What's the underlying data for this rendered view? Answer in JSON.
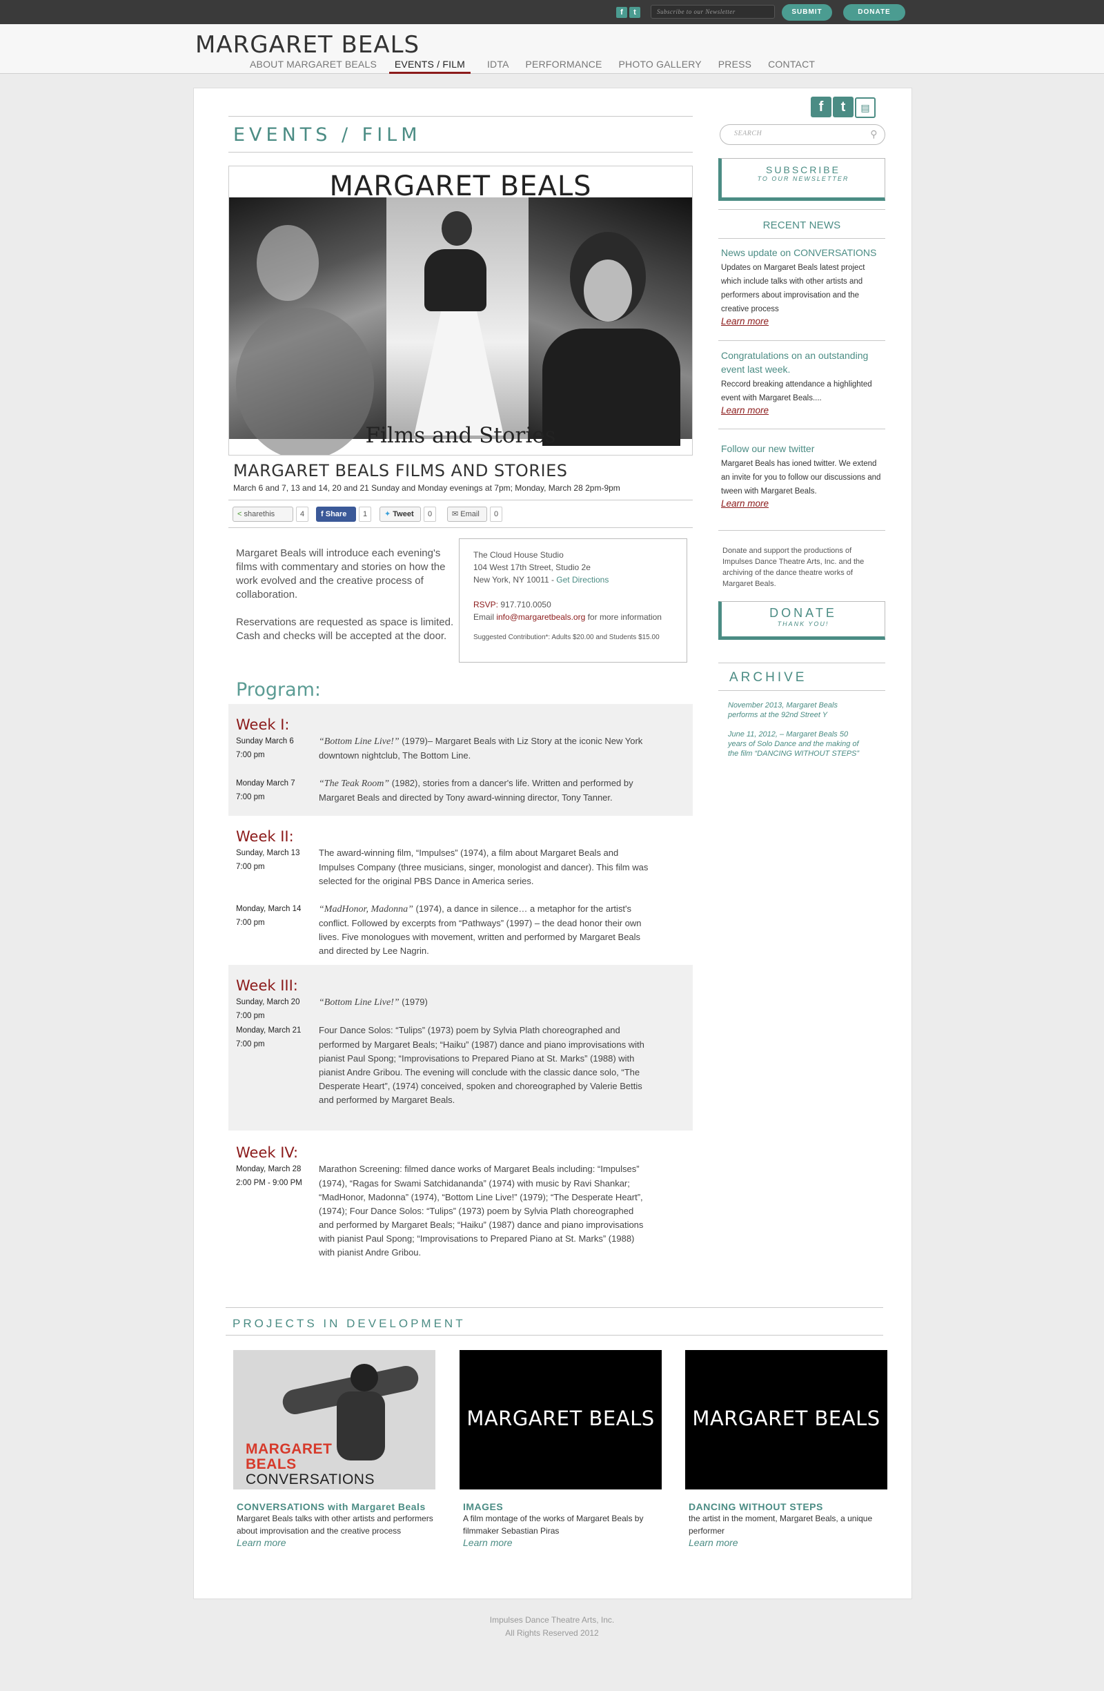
{
  "topbar": {
    "newsletter_placeholder": "Subscribe to our Newsletter",
    "submit_label": "SUBMIT",
    "donate_label": "DONATE"
  },
  "header": {
    "logo": "MARGARET BEALS",
    "nav": [
      {
        "label": "ABOUT MARGARET BEALS",
        "active": false
      },
      {
        "label": "EVENTS / FILM",
        "active": true
      },
      {
        "label": "IDTA",
        "active": false
      },
      {
        "label": "PERFORMANCE",
        "active": false
      },
      {
        "label": "PHOTO GALLERY",
        "active": false
      },
      {
        "label": "PRESS",
        "active": false
      },
      {
        "label": "CONTACT",
        "active": false
      }
    ]
  },
  "main": {
    "page_title": "EVENTS / FILM",
    "hero": {
      "title": "MARGARET BEALS",
      "subtitle": "Films and Stories"
    },
    "event": {
      "title": "MARGARET BEALS  FILMS AND STORIES",
      "dates": "March 6 and 7, 13 and 14, 20 and 21 Sunday and Monday evenings at 7pm; Monday, March 28 2pm-9pm"
    },
    "share": {
      "sharethis_label": "sharethis",
      "sharethis_count": "4",
      "fb_label": "Share",
      "fb_count": "1",
      "tweet_label": "Tweet",
      "tweet_count": "0",
      "email_label": "Email",
      "email_count": "0"
    },
    "intro": [
      "Margaret Beals will introduce each evening's films with commentary and stories on how the work evolved and the creative process of collaboration.",
      "Reservations are requested as space is limited. Cash and checks will be accepted at the door."
    ],
    "venue": {
      "name": "The Cloud House Studio",
      "street": "104 West 17th Street, Studio 2e",
      "city": "New York, NY 10011 - ",
      "directions": "Get Directions",
      "rsvp_label": "RSVP:",
      "rsvp_phone": " 917.710.0050",
      "email_prefix": "Email ",
      "email": "info@margaretbeals.org",
      "email_suffix": " for more information",
      "contribution": "Suggested Contribution*: Adults $20.00 and Students $15.00"
    },
    "program_title": "Program:",
    "weeks": [
      {
        "title": "Week I:",
        "entries": [
          {
            "day": "Sunday March 6",
            "time": "7:00 pm",
            "title": "“Bottom Line Live!”",
            "text": " (1979)– Margaret Beals with Liz Story at the iconic New York downtown nightclub, The Bottom Line."
          },
          {
            "day": "Monday March 7",
            "time": "7:00 pm",
            "title": " “The Teak Room”",
            "text": " (1982), stories from a dancer's life. Written and performed by Margaret Beals and directed by Tony award-winning director, Tony Tanner."
          }
        ]
      },
      {
        "title": "Week II:",
        "entries": [
          {
            "day": "Sunday, March 13",
            "time": "7:00 pm",
            "title": "",
            "text": "The award-winning film, “Impulses” (1974), a film about Margaret Beals and Impulses Company (three musicians, singer, monologist and dancer). This film was selected for the original PBS Dance in America series."
          },
          {
            "day": "Monday, March 14",
            "time": "7:00 pm",
            "title": "“MadHonor, Madonna”",
            "text": " (1974), a dance in silence… a metaphor for the artist's conflict. Followed by excerpts from “Pathways” (1997) – the dead honor their own lives. Five monologues with movement, written and performed by Margaret Beals and directed by Lee Nagrin."
          }
        ]
      },
      {
        "title": "Week III:",
        "entries": [
          {
            "day": "Sunday, March 20",
            "time": "7:00 pm",
            "title": "“Bottom Line Live!”",
            "text": " (1979)"
          },
          {
            "day": "Monday, March 21",
            "time": "7:00 pm",
            "title": "",
            "text": "Four Dance Solos: “Tulips” (1973) poem by Sylvia Plath choreographed and performed by Margaret Beals; “Haiku” (1987) dance and piano improvisations with pianist Paul Spong; “Improvisations to Prepared Piano at St. Marks” (1988) with pianist Andre Gribou. The evening will conclude with the classic dance solo, “The Desperate Heart”, (1974) conceived, spoken and choreographed by Valerie Bettis and performed by Margaret Beals."
          }
        ]
      },
      {
        "title": "Week IV:",
        "entries": [
          {
            "day": "Monday, March 28",
            "time": "2:00 PM - 9:00 PM",
            "title": "",
            "text": "Marathon Screening: filmed dance works of Margaret Beals including: “Impulses” (1974), “Ragas for Swami Satchidananda” (1974) with music by Ravi Shankar; “MadHonor, Madonna” (1974), “Bottom Line Live!” (1979); “The Desperate Heart”, (1974); Four Dance Solos: “Tulips” (1973) poem by Sylvia Plath choreographed and performed by Margaret Beals; “Haiku” (1987) dance and piano improvisations with pianist Paul Spong; “Improvisations to Prepared Piano at St. Marks” (1988) with pianist Andre Gribou."
          }
        ]
      }
    ],
    "projects_title": "PROJECTS IN DEVELOPMENT",
    "projects": [
      {
        "thumb_line1": "MARGARET",
        "thumb_line2": "BEALS",
        "thumb_line3": "CONVERSATIONS",
        "title": "CONVERSATIONS with Margaret Beals",
        "desc": " Margaret Beals talks with other artists and performers about improvisation and the creative process",
        "link": "Learn more"
      },
      {
        "thumb_text": "MARGARET BEALS",
        "title": "IMAGES",
        "desc": "A film montage of the works of Margaret Beals by filmmaker Sebastian Piras",
        "link": "Learn more"
      },
      {
        "thumb_text": "MARGARET BEALS",
        "title": "DANCING WITHOUT STEPS",
        "desc": "the artist in the moment, Margaret Beals, a unique performer",
        "link": "Learn more"
      }
    ]
  },
  "sidebar": {
    "search_placeholder": "SEARCH",
    "subscribe_big": "SUBSCRIBE",
    "subscribe_small": "TO OUR NEWSLETTER",
    "recent_news_title": "RECENT NEWS",
    "news": [
      {
        "title": "News update on CONVERSATIONS",
        "desc": "Updates on Margaret Beals latest project which include talks with other artists and performers about improvisation and the creative process",
        "link": "Learn more"
      },
      {
        "title": "Congratulations on an outstanding event last week.",
        "desc": "Reccord breaking attendance a highlighted event with Margaret Beals....",
        "link": "Learn more"
      },
      {
        "title": "Follow our new twitter",
        "desc": "Margaret Beals has ioned twitter. We extend an invite for you to follow our discussions and tween with Margaret Beals.",
        "link": "Learn more"
      }
    ],
    "donate_text": "Donate and support the productions of Impulses Dance Theatre Arts, Inc. and the archiving of the dance theatre works of Margaret Beals.",
    "donate_big": "DONATE",
    "donate_small": "THANK YOU!",
    "archive_title": "ARCHIVE",
    "archive": [
      "November 2013, Margaret Beals performs at the 92nd Street Y",
      "June 11, 2012, – Margaret Beals 50 years of Solo Dance and the making of the film “DANCING WITHOUT STEPS”"
    ]
  },
  "footer": {
    "line1": "Impulses Dance Theatre Arts, Inc.",
    "line2": "All Rights Reserved 2012"
  }
}
